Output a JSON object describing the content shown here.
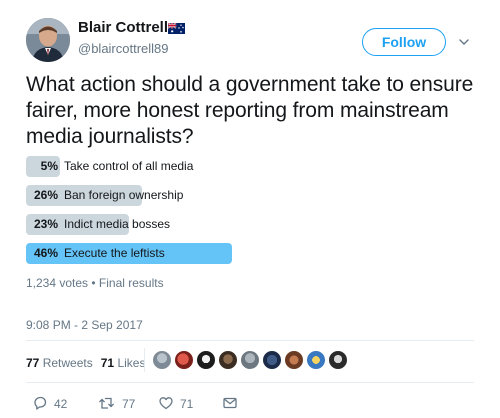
{
  "author": {
    "name": "Blair Cottrell",
    "handle": "@blaircottrell89",
    "flag_icon": "australian-flag-icon"
  },
  "follow_label": "Follow",
  "tweet_text": "What action should a government take to ensure fairer, more honest reporting from mainstream media journalists?",
  "poll": {
    "options": [
      {
        "pct": "5%",
        "label": "Take control of all media",
        "value": 5,
        "winner": false
      },
      {
        "pct": "26%",
        "label": "Ban foreign ownership",
        "value": 26,
        "winner": false
      },
      {
        "pct": "23%",
        "label": "Indict media bosses",
        "value": 23,
        "winner": false
      },
      {
        "pct": "46%",
        "label": "Execute the leftists",
        "value": 46,
        "winner": true
      }
    ],
    "meta": "1,234 votes • Final results"
  },
  "timestamp": "9:08 PM - 2 Sep 2017",
  "stats": {
    "retweets_count": "77",
    "retweets_label": "Retweets",
    "likes_count": "71",
    "likes_label": "Likes"
  },
  "actions": {
    "reply_count": "42",
    "retweet_count": "77",
    "like_count": "71"
  },
  "colors": {
    "accent": "#1da1f2",
    "poll_winner": "#64c3f7",
    "poll_bar": "#ccd6dd",
    "muted_text": "#657786"
  }
}
